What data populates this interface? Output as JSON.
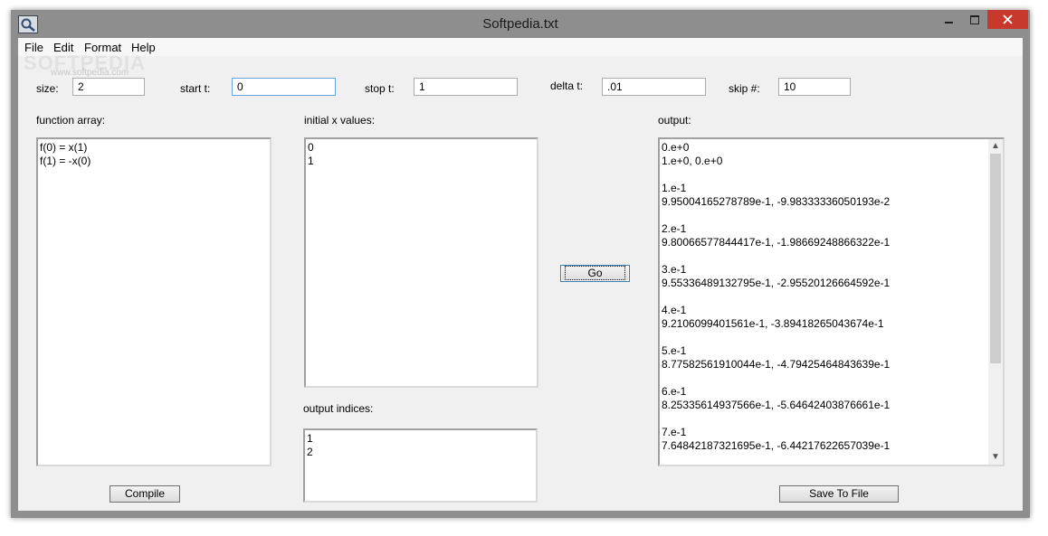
{
  "window": {
    "title": "Softpedia.txt"
  },
  "menu": {
    "items": [
      "File",
      "Edit",
      "Format",
      "Help"
    ]
  },
  "watermark": {
    "brand": "SOFTPEDIA",
    "url": "www.softpedia.com"
  },
  "params": {
    "size": {
      "label": "size:",
      "value": "2"
    },
    "start_t": {
      "label": "start t:",
      "value": "0"
    },
    "stop_t": {
      "label": "stop t:",
      "value": "1"
    },
    "delta_t": {
      "label": "delta t:",
      "value": ".01"
    },
    "skip": {
      "label": "skip #:",
      "value": "10"
    }
  },
  "function_array": {
    "label": "function array:",
    "lines": [
      "f(0) = x(1)",
      "f(1) = -x(0)"
    ]
  },
  "initial_x": {
    "label": "initial x values:",
    "lines": [
      "0",
      "1"
    ]
  },
  "output_indices": {
    "label": "output indices:",
    "lines": [
      "1",
      "2"
    ]
  },
  "buttons": {
    "compile": "Compile",
    "go": "Go",
    "save": "Save To File"
  },
  "output": {
    "label": "output:",
    "lines": [
      "0.e+0",
      "1.e+0, 0.e+0",
      "",
      "1.e-1",
      "9.95004165278789e-1, -9.98333336050193e-2",
      "",
      "2.e-1",
      "9.80066577844417e-1, -1.98669248866322e-1",
      "",
      "3.e-1",
      "9.55336489132795e-1, -2.95520126664592e-1",
      "",
      "4.e-1",
      "9.2106099401561e-1, -3.89418265043674e-1",
      "",
      "5.e-1",
      "8.77582561910044e-1, -4.79425464843639e-1",
      "",
      "6.e-1",
      "8.25335614937566e-1, -5.64642403876661e-1",
      "",
      "7.e-1",
      "7.64842187321695e-1, -6.44217622657039e-1"
    ]
  }
}
